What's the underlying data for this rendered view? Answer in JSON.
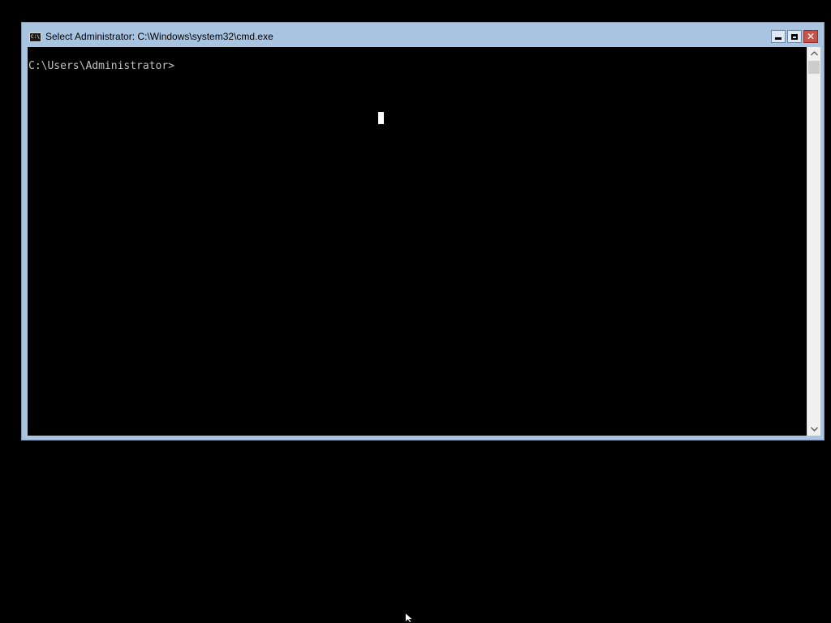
{
  "window": {
    "title": "Select Administrator: C:\\Windows\\system32\\cmd.exe",
    "icon": "cmd-app-icon",
    "icon_text": "C:\\.",
    "controls": {
      "minimize": "minimize-icon",
      "maximize": "maximize-icon",
      "close": "close-icon",
      "close_glyph": "✕"
    }
  },
  "console": {
    "prompt": "C:\\Users\\Administrator>",
    "text_color": "#c0c0c0",
    "background": "#000000"
  },
  "colors": {
    "titlebar": "#a9c4e0",
    "close_button": "#c7544a",
    "desktop": "#000000"
  }
}
